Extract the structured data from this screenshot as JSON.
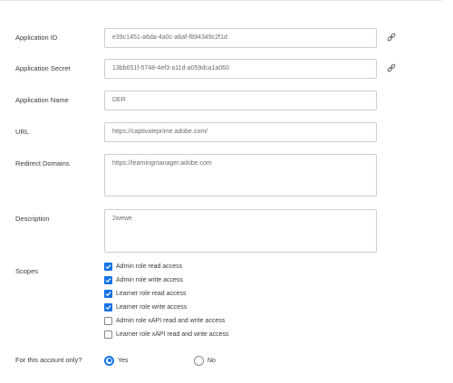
{
  "form": {
    "application_id": {
      "label": "Application ID",
      "value": "e39c1451-a6da-4a0c-a6af-f894349c2f1d"
    },
    "application_secret": {
      "label": "Application Secret",
      "value": "13bb651f-5748-4ef3-a11d-a059dca1a060"
    },
    "application_name": {
      "label": "Application Name",
      "value": "DER"
    },
    "url": {
      "label": "URL",
      "value": "https://captivateprime.adobe.com/"
    },
    "redirect_domains": {
      "label": "Redirect Domains",
      "value": "https://learningmanager.adobe.com"
    },
    "description": {
      "label": "Description",
      "value": "2wewe"
    },
    "scopes": {
      "label": "Scopes",
      "items": [
        {
          "label": "Admin role read access",
          "checked": true
        },
        {
          "label": "Admin role write access",
          "checked": true
        },
        {
          "label": "Learner role read access",
          "checked": true
        },
        {
          "label": "Learner role write access",
          "checked": true
        },
        {
          "label": "Admin role xAPI read and write access",
          "checked": false
        },
        {
          "label": "Learner role xAPI read and write access",
          "checked": false
        }
      ]
    },
    "account_only": {
      "label": "For this account only?",
      "options": [
        {
          "label": "Yes",
          "selected": true
        },
        {
          "label": "No",
          "selected": false
        }
      ]
    }
  },
  "icons": {
    "copy_link": "link-icon"
  },
  "colors": {
    "accent": "#1473e6",
    "border": "#cfcfcf",
    "label_text": "#3a3a3a",
    "value_text": "#6d6d6d"
  }
}
